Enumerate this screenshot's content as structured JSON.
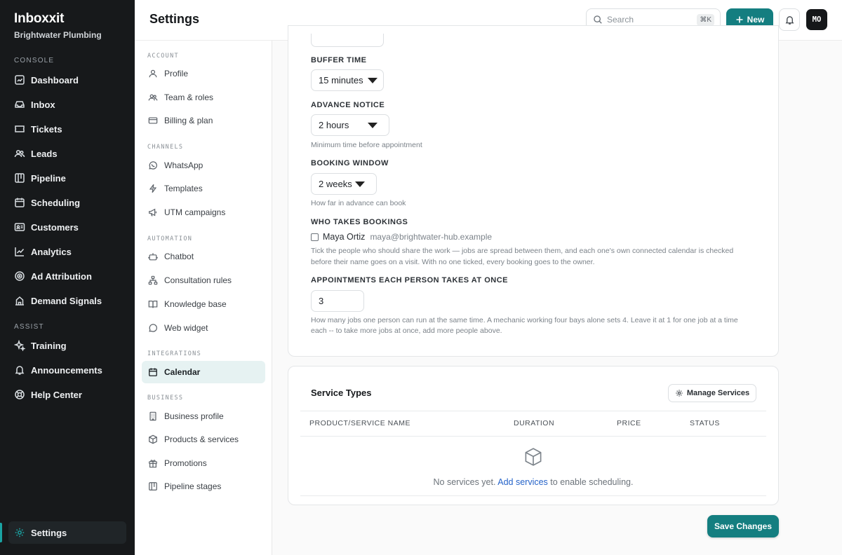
{
  "brand": {
    "name": "Inboxxit",
    "subtitle": "Brightwater Plumbing"
  },
  "sidebar": {
    "section_console": "CONSOLE",
    "section_assist": "ASSIST",
    "items": [
      {
        "label": "Dashboard",
        "icon": "dashboard-icon"
      },
      {
        "label": "Inbox",
        "icon": "inbox-icon"
      },
      {
        "label": "Tickets",
        "icon": "ticket-icon"
      },
      {
        "label": "Leads",
        "icon": "users-icon"
      },
      {
        "label": "Pipeline",
        "icon": "pipeline-icon"
      },
      {
        "label": "Scheduling",
        "icon": "calendar-icon"
      },
      {
        "label": "Customers",
        "icon": "contact-card-icon"
      },
      {
        "label": "Analytics",
        "icon": "trend-icon"
      },
      {
        "label": "Ad Attribution",
        "icon": "target-icon"
      },
      {
        "label": "Demand Signals",
        "icon": "building-icon"
      }
    ],
    "assist_items": [
      {
        "label": "Training",
        "icon": "sparkle-icon"
      },
      {
        "label": "Announcements",
        "icon": "bell-icon"
      },
      {
        "label": "Help Center",
        "icon": "lifebuoy-icon"
      }
    ],
    "settings_label": "Settings"
  },
  "header": {
    "title": "Settings",
    "search_placeholder": "Search",
    "search_shortcut": "⌘K",
    "new_label": "New",
    "avatar_initials": "MO"
  },
  "subnav": {
    "sections": {
      "account": "ACCOUNT",
      "channels": "CHANNELS",
      "automation": "AUTOMATION",
      "integrations": "INTEGRATIONS",
      "business": "BUSINESS"
    },
    "items": {
      "profile": "Profile",
      "team": "Team & roles",
      "billing": "Billing & plan",
      "whatsapp": "WhatsApp",
      "templates": "Templates",
      "utm": "UTM campaigns",
      "chatbot": "Chatbot",
      "consultation": "Consultation rules",
      "knowledge": "Knowledge base",
      "widget": "Web widget",
      "calendar": "Calendar",
      "business_profile": "Business profile",
      "products": "Products & services",
      "promotions": "Promotions",
      "pipeline_stages": "Pipeline stages"
    }
  },
  "form": {
    "buffer_label": "BUFFER TIME",
    "buffer_value": "15 minutes",
    "advance_label": "ADVANCE NOTICE",
    "advance_value": "2 hours",
    "advance_hint": "Minimum time before appointment",
    "window_label": "BOOKING WINDOW",
    "window_value": "2 weeks",
    "window_hint": "How far in advance can book",
    "who_label": "WHO TAKES BOOKINGS",
    "person_name": "Maya Ortiz",
    "person_email": "maya@brightwater-hub.example",
    "who_hint_1": "Tick the people who should share the work — jobs are spread between them, and each one's own connected calendar is checked",
    "who_hint_2": "before their name goes on a visit. With no one ticked, every booking goes to the owner.",
    "capacity_label": "APPOINTMENTS EACH PERSON TAKES AT ONCE",
    "capacity_value": "3",
    "capacity_hint_1": "How many jobs one person can run at the same time. A mechanic working four bays alone sets 4. Leave it at 1 for one job at a time",
    "capacity_hint_2": "each -- to take more jobs at once, add more people above."
  },
  "services": {
    "title": "Service Types",
    "manage_label": "Manage Services",
    "columns": [
      "PRODUCT/SERVICE NAME",
      "DURATION",
      "PRICE",
      "STATUS"
    ],
    "empty_prefix": "No services yet.",
    "empty_link": "Add services",
    "empty_suffix": "to enable scheduling."
  },
  "save_label": "Save Changes",
  "colors": {
    "accent": "#147e80",
    "sidebar_bg": "#17191b",
    "active_nav": "#e6f2f2",
    "link": "#2563c9"
  }
}
